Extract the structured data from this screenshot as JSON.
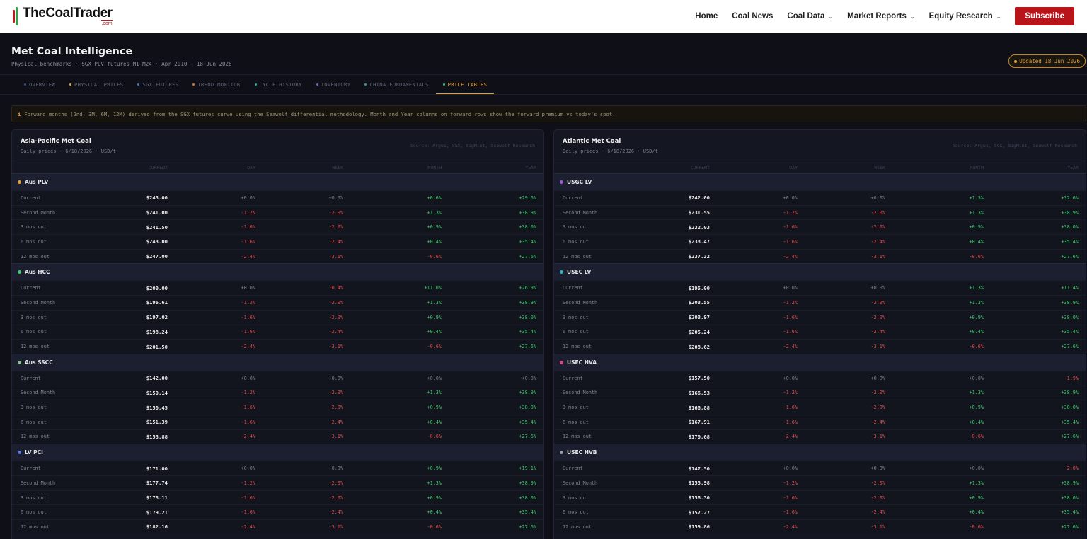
{
  "nav": {
    "logo_main": "TheCoalTrader",
    "logo_sub": ".com",
    "links": [
      {
        "label": "Home",
        "caret": false
      },
      {
        "label": "Coal News",
        "caret": false
      },
      {
        "label": "Coal Data",
        "caret": true
      },
      {
        "label": "Market Reports",
        "caret": true
      },
      {
        "label": "Equity Research",
        "caret": true
      }
    ],
    "subscribe": "Subscribe"
  },
  "header": {
    "title": "Met Coal Intelligence",
    "subtitle": "Physical benchmarks · SGX PLV futures M1–M24 · Apr 2010 – 18 Jun 2026",
    "updated": "Updated 18 Jun 2026"
  },
  "tabs": [
    {
      "label": "OVERVIEW",
      "color": "#3d4b8a",
      "active": false
    },
    {
      "label": "PHYSICAL PRICES",
      "color": "#e3a13a",
      "active": false
    },
    {
      "label": "SGX FUTURES",
      "color": "#3b7bd1",
      "active": false
    },
    {
      "label": "TREND MONITOR",
      "color": "#d4742a",
      "active": false
    },
    {
      "label": "CYCLE HISTORY",
      "color": "#1fb0a0",
      "active": false
    },
    {
      "label": "INVENTORY",
      "color": "#7e5bc9",
      "active": false
    },
    {
      "label": "CHINA FUNDAMENTALS",
      "color": "#2b9c8c",
      "active": false
    },
    {
      "label": "PRICE TABLES",
      "color": "#3fcb6a",
      "active": true
    }
  ],
  "banner": {
    "icon": "i",
    "text": "Forward months (2nd, 3M, 6M, 12M) derived from the SGX futures curve using the Seawolf differential methodology. Month and Year columns on forward rows show the forward premium vs today's spot."
  },
  "columns": [
    "CURRENT",
    "DAY",
    "WEEK",
    "MONTH",
    "YEAR"
  ],
  "panels": [
    {
      "title": "Asia-Pacific Met Coal",
      "subtitle": "Daily prices · 6/18/2026 · USD/t",
      "source": "Source: Argus, SGX, BigMint, Seawolf Research",
      "groups": [
        {
          "name": "Aus PLV",
          "color": "#e3a13a",
          "rows": [
            [
              "Current",
              "$243.00",
              "+0.0%",
              "+0.0%",
              "+0.6%",
              "+29.6%"
            ],
            [
              "Second Month",
              "$241.00",
              "-1.2%",
              "-2.0%",
              "+1.3%",
              "+38.9%"
            ],
            [
              "3 mos out",
              "$241.50",
              "-1.6%",
              "-2.0%",
              "+0.9%",
              "+38.0%"
            ],
            [
              "6 mos out",
              "$243.00",
              "-1.6%",
              "-2.4%",
              "+0.4%",
              "+35.4%"
            ],
            [
              "12 mos out",
              "$247.00",
              "-2.4%",
              "-3.1%",
              "-0.6%",
              "+27.6%"
            ]
          ]
        },
        {
          "name": "Aus HCC",
          "color": "#3fcb6a",
          "rows": [
            [
              "Current",
              "$200.00",
              "+0.0%",
              "-0.4%",
              "+11.0%",
              "+26.9%"
            ],
            [
              "Second Month",
              "$196.61",
              "-1.2%",
              "-2.0%",
              "+1.3%",
              "+38.9%"
            ],
            [
              "3 mos out",
              "$197.02",
              "-1.6%",
              "-2.0%",
              "+0.9%",
              "+38.0%"
            ],
            [
              "6 mos out",
              "$198.24",
              "-1.6%",
              "-2.4%",
              "+0.4%",
              "+35.4%"
            ],
            [
              "12 mos out",
              "$201.50",
              "-2.4%",
              "-3.1%",
              "-0.6%",
              "+27.6%"
            ]
          ]
        },
        {
          "name": "Aus SSCC",
          "color": "#8bbf8b",
          "rows": [
            [
              "Current",
              "$142.00",
              "+0.0%",
              "+0.0%",
              "+0.0%",
              "+0.0%"
            ],
            [
              "Second Month",
              "$150.14",
              "-1.2%",
              "-2.0%",
              "+1.3%",
              "+38.9%"
            ],
            [
              "3 mos out",
              "$150.45",
              "-1.6%",
              "-2.0%",
              "+0.9%",
              "+38.0%"
            ],
            [
              "6 mos out",
              "$151.39",
              "-1.6%",
              "-2.4%",
              "+0.4%",
              "+35.4%"
            ],
            [
              "12 mos out",
              "$153.88",
              "-2.4%",
              "-3.1%",
              "-0.6%",
              "+27.6%"
            ]
          ]
        },
        {
          "name": "LV PCI",
          "color": "#5a7be0",
          "rows": [
            [
              "Current",
              "$171.00",
              "+0.0%",
              "+0.0%",
              "+0.9%",
              "+19.1%"
            ],
            [
              "Second Month",
              "$177.74",
              "-1.2%",
              "-2.0%",
              "+1.3%",
              "+38.9%"
            ],
            [
              "3 mos out",
              "$178.11",
              "-1.6%",
              "-2.0%",
              "+0.9%",
              "+38.0%"
            ],
            [
              "6 mos out",
              "$179.21",
              "-1.6%",
              "-2.4%",
              "+0.4%",
              "+35.4%"
            ],
            [
              "12 mos out",
              "$182.16",
              "-2.4%",
              "-3.1%",
              "-0.6%",
              "+27.6%"
            ]
          ]
        }
      ]
    },
    {
      "title": "Atlantic Met Coal",
      "subtitle": "Daily prices · 6/18/2026 · USD/t",
      "source": "Source: Argus, SGX, BigMint, Seawolf Research",
      "groups": [
        {
          "name": "USGC LV",
          "color": "#9b5bd6",
          "rows": [
            [
              "Current",
              "$242.00",
              "+0.0%",
              "+0.0%",
              "+1.3%",
              "+32.6%"
            ],
            [
              "Second Month",
              "$231.55",
              "-1.2%",
              "-2.0%",
              "+1.3%",
              "+38.9%"
            ],
            [
              "3 mos out",
              "$232.03",
              "-1.6%",
              "-2.0%",
              "+0.9%",
              "+38.0%"
            ],
            [
              "6 mos out",
              "$233.47",
              "-1.6%",
              "-2.4%",
              "+0.4%",
              "+35.4%"
            ],
            [
              "12 mos out",
              "$237.32",
              "-2.4%",
              "-3.1%",
              "-0.6%",
              "+27.6%"
            ]
          ]
        },
        {
          "name": "USEC LV",
          "color": "#2bb4c4",
          "rows": [
            [
              "Current",
              "$195.00",
              "+0.0%",
              "+0.0%",
              "+1.3%",
              "+11.4%"
            ],
            [
              "Second Month",
              "$203.55",
              "-1.2%",
              "-2.0%",
              "+1.3%",
              "+38.9%"
            ],
            [
              "3 mos out",
              "$203.97",
              "-1.6%",
              "-2.0%",
              "+0.9%",
              "+38.0%"
            ],
            [
              "6 mos out",
              "$205.24",
              "-1.6%",
              "-2.4%",
              "+0.4%",
              "+35.4%"
            ],
            [
              "12 mos out",
              "$208.62",
              "-2.4%",
              "-3.1%",
              "-0.6%",
              "+27.6%"
            ]
          ]
        },
        {
          "name": "USEC HVA",
          "color": "#d9467e",
          "rows": [
            [
              "Current",
              "$157.50",
              "+0.0%",
              "+0.0%",
              "+0.0%",
              "-1.9%"
            ],
            [
              "Second Month",
              "$166.53",
              "-1.2%",
              "-2.0%",
              "+1.3%",
              "+38.9%"
            ],
            [
              "3 mos out",
              "$166.88",
              "-1.6%",
              "-2.0%",
              "+0.9%",
              "+38.0%"
            ],
            [
              "6 mos out",
              "$167.91",
              "-1.6%",
              "-2.4%",
              "+0.4%",
              "+35.4%"
            ],
            [
              "12 mos out",
              "$170.68",
              "-2.4%",
              "-3.1%",
              "-0.6%",
              "+27.6%"
            ]
          ]
        },
        {
          "name": "USEC HVB",
          "color": "#9aa0ad",
          "rows": [
            [
              "Current",
              "$147.50",
              "+0.0%",
              "+0.0%",
              "+0.0%",
              "-2.0%"
            ],
            [
              "Second Month",
              "$155.98",
              "-1.2%",
              "-2.0%",
              "+1.3%",
              "+38.9%"
            ],
            [
              "3 mos out",
              "$156.30",
              "-1.6%",
              "-2.0%",
              "+0.9%",
              "+38.0%"
            ],
            [
              "6 mos out",
              "$157.27",
              "-1.6%",
              "-2.4%",
              "+0.4%",
              "+35.4%"
            ],
            [
              "12 mos out",
              "$159.86",
              "-2.4%",
              "-3.1%",
              "-0.6%",
              "+27.6%"
            ]
          ]
        }
      ]
    }
  ]
}
